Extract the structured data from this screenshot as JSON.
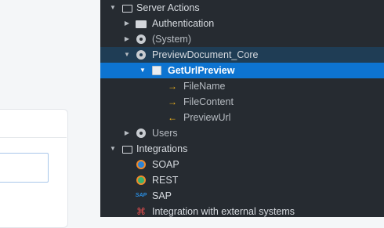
{
  "tree": {
    "items": [
      {
        "label": "Server Actions",
        "arrow": "▼",
        "icon": "folder-open-icon"
      },
      {
        "label": "Authentication",
        "arrow": "▶",
        "icon": "folder-icon"
      },
      {
        "label": "(System)",
        "arrow": "▶",
        "icon": "module-icon"
      },
      {
        "label": "PreviewDocument_Core",
        "arrow": "▼",
        "icon": "module-icon"
      },
      {
        "label": "GetUrlPreview",
        "arrow": "▼",
        "icon": "server-action-icon"
      },
      {
        "label": "FileName",
        "arrow": "",
        "icon": "input-parameter-icon"
      },
      {
        "label": "FileContent",
        "arrow": "",
        "icon": "input-parameter-icon"
      },
      {
        "label": "PreviewUrl",
        "arrow": "",
        "icon": "output-parameter-icon"
      },
      {
        "label": "Users",
        "arrow": "▶",
        "icon": "module-icon"
      },
      {
        "label": "Integrations",
        "arrow": "▼",
        "icon": "folder-open-icon"
      },
      {
        "label": "SOAP",
        "arrow": "",
        "icon": "soap-icon"
      },
      {
        "label": "REST",
        "arrow": "",
        "icon": "rest-icon"
      },
      {
        "label": "SAP",
        "arrow": "",
        "icon": "sap-icon",
        "icon_text": "SAP"
      },
      {
        "label": "Integration with external systems",
        "arrow": "",
        "icon": "external-systems-icon"
      }
    ]
  },
  "colors": {
    "tree_bg": "#262b31",
    "selected_bg": "#0d74d1",
    "parent_highlight_bg": "#1f3d55",
    "text": "#d7dbe0",
    "parameter_accent": "#f0b31c"
  }
}
